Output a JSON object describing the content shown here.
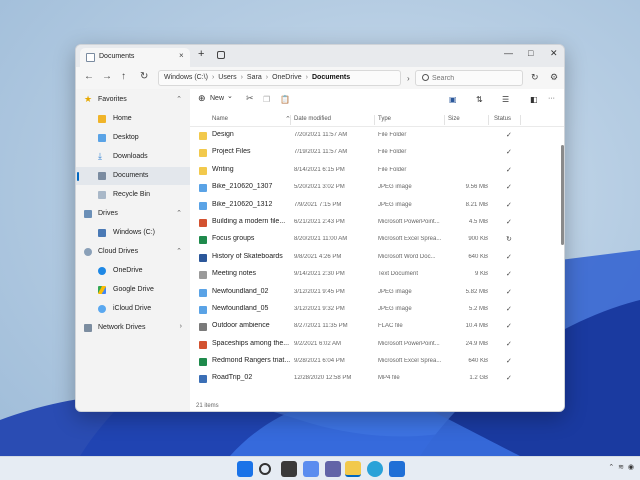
{
  "window": {
    "tab_title": "Documents",
    "tab_close": "×",
    "new_tab": "+",
    "minimize": "—",
    "maximize": "□",
    "close": "✕"
  },
  "nav": {
    "back": "←",
    "forward": "→",
    "up": "↑",
    "refresh": "↻",
    "address": [
      "Windows (C:\\)",
      "Users",
      "Sara",
      "OneDrive",
      "Documents"
    ],
    "search_placeholder": "Search"
  },
  "toolbar": {
    "new_label": "New",
    "new_chevron": "⌄",
    "more": "···"
  },
  "sidebar": {
    "items": [
      {
        "label": "Favorites",
        "chevron": "⌃"
      },
      {
        "label": "Home"
      },
      {
        "label": "Desktop"
      },
      {
        "label": "Downloads"
      },
      {
        "label": "Documents"
      },
      {
        "label": "Recycle Bin"
      },
      {
        "label": "Drives",
        "chevron": "⌃"
      },
      {
        "label": "Windows (C:)"
      },
      {
        "label": "Cloud Drives",
        "chevron": "⌃"
      },
      {
        "label": "OneDrive"
      },
      {
        "label": "Google Drive"
      },
      {
        "label": "iCloud Drive"
      },
      {
        "label": "Network Drives",
        "chevron": "›"
      }
    ]
  },
  "columns": {
    "name": "Name",
    "date": "Date modified",
    "type": "Type",
    "size": "Size",
    "status": "Status"
  },
  "files": [
    {
      "name": "Design",
      "date": "7/20/2021 11:57 AM",
      "type": "File Folder",
      "size": "",
      "status": "✓",
      "kind": "folder"
    },
    {
      "name": "Project Files",
      "date": "7/19/2021 11:57 AM",
      "type": "File Folder",
      "size": "",
      "status": "✓",
      "kind": "folder"
    },
    {
      "name": "Writing",
      "date": "8/14/2021 6:15 PM",
      "type": "File Folder",
      "size": "",
      "status": "✓",
      "kind": "folder"
    },
    {
      "name": "Bike_210620_1307",
      "date": "5/20/2021 3:02 PM",
      "type": "JPEG image",
      "size": "9.56 MB",
      "status": "✓",
      "kind": "image"
    },
    {
      "name": "Bike_210620_1312",
      "date": "7/9/2021 7:15 PM",
      "type": "JPEG image",
      "size": "8.21 MB",
      "status": "✓",
      "kind": "image"
    },
    {
      "name": "Building a modern file...",
      "date": "6/21/2021 2:43 PM",
      "type": "Microsoft PowerPoint...",
      "size": "4.5 MB",
      "status": "✓",
      "kind": "ppt"
    },
    {
      "name": "Focus groups",
      "date": "8/20/2021 11:00 AM",
      "type": "Microsoft Excel Sprea...",
      "size": "900 KB",
      "status": "↻",
      "kind": "excel"
    },
    {
      "name": "History of Skateboards",
      "date": "9/8/2021 4:26 PM",
      "type": "Microsoft Word Doc...",
      "size": "640 KB",
      "status": "✓",
      "kind": "word"
    },
    {
      "name": "Meeting notes",
      "date": "9/14/2021 2:30 PM",
      "type": "Text Document",
      "size": "9 KB",
      "status": "✓",
      "kind": "text"
    },
    {
      "name": "Newfoundland_02",
      "date": "3/12/2021 9:45 PM",
      "type": "JPEG image",
      "size": "5.82 MB",
      "status": "✓",
      "kind": "image"
    },
    {
      "name": "Newfoundland_05",
      "date": "3/12/2021 9:32 PM",
      "type": "JPEG image",
      "size": "5.2 MB",
      "status": "✓",
      "kind": "image"
    },
    {
      "name": "Outdoor ambience",
      "date": "8/27/2021 11:35 PM",
      "type": "FLAC file",
      "size": "10.4 MB",
      "status": "✓",
      "kind": "audio"
    },
    {
      "name": "Spaceships among the...",
      "date": "9/2/2021 6:02 AM",
      "type": "Microsoft PowerPoint...",
      "size": "24.9 MB",
      "status": "✓",
      "kind": "ppt"
    },
    {
      "name": "Redmond Rangers triat...",
      "date": "9/28/2021 6:04 PM",
      "type": "Microsoft Excel Sprea...",
      "size": "640 KB",
      "status": "✓",
      "kind": "excel"
    },
    {
      "name": "RoadTrip_02",
      "date": "12/28/2020 12:58 PM",
      "type": "MP4 file",
      "size": "1.2 GB",
      "status": "✓",
      "kind": "video"
    }
  ],
  "status_bar": "21 items",
  "colors": {
    "folder": "#f2c94c",
    "image": "#5aa3e6",
    "ppt": "#d35230",
    "excel": "#1f8a4c",
    "word": "#2b579a",
    "text": "#9a9a9a",
    "audio": "#7a7a7a",
    "video": "#3b6fb6",
    "accent": "#0067c0"
  }
}
